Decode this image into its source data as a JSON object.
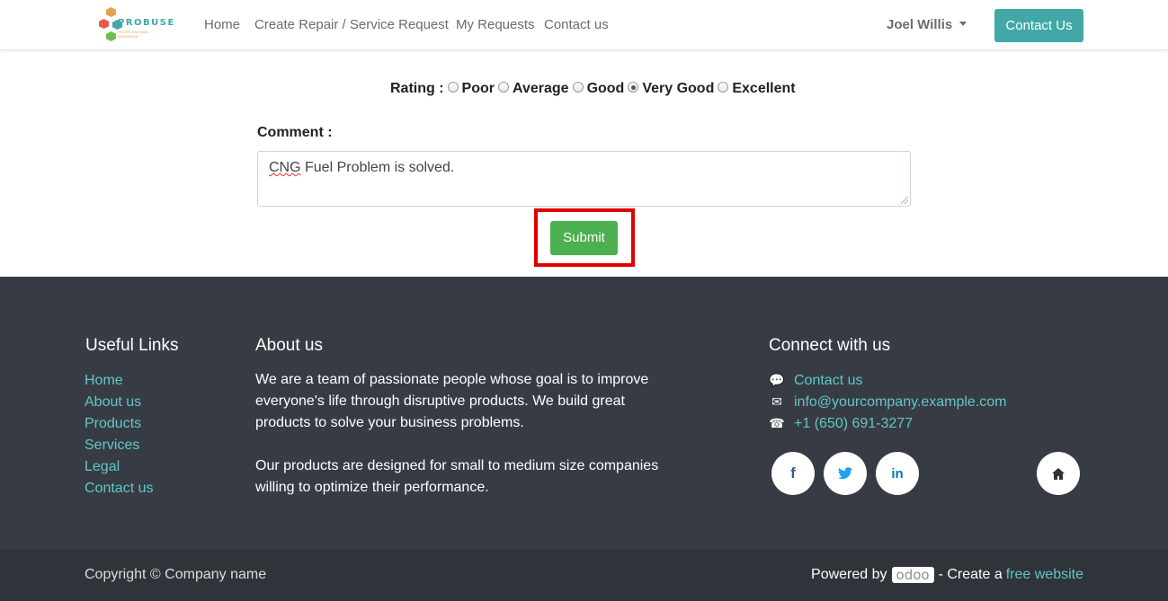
{
  "brand": {
    "logo_text": "PROBUSE",
    "logo_subtext": "PROFESSIONAL BUSINESS",
    "colors": {
      "teal": "#41a8a7",
      "orange": "#e8a04b",
      "green": "#4caf50",
      "red": "#e8594b"
    }
  },
  "nav": {
    "links": [
      "Home",
      "Create Repair / Service Request",
      "My Requests",
      "Contact us"
    ],
    "user_name": "Joel Willis",
    "cta_label": "Contact Us"
  },
  "form": {
    "rating_label": "Rating :",
    "rating_options": [
      "Poor",
      "Average",
      "Good",
      "Very Good",
      "Excellent"
    ],
    "selected_rating": "Good",
    "comment_label": "Comment :",
    "comment_spell_word": "CNG",
    "comment_rest": " Fuel Problem is solved.",
    "submit_label": "Submit"
  },
  "footer": {
    "useful_links_title": "Useful Links",
    "useful_links": [
      "Home",
      "About us",
      "Products",
      "Services",
      "Legal",
      "Contact us"
    ],
    "about_title": "About us",
    "about_p1": "We are a team of passionate people whose goal is to improve everyone's life through disruptive products. We build great products to solve your business problems.",
    "about_p2": "Our products are designed for small to medium size companies willing to optimize their performance.",
    "connect_title": "Connect with us",
    "contact_items": [
      {
        "icon": "comment-icon",
        "text": "Contact us"
      },
      {
        "icon": "envelope-icon",
        "text": "info@yourcompany.example.com"
      },
      {
        "icon": "phone-icon",
        "text": "+1 (650) 691-3277"
      }
    ],
    "social": [
      {
        "icon": "facebook-icon",
        "glyph": "f",
        "color": "#3b5998"
      },
      {
        "icon": "twitter-icon",
        "glyph": "🐦",
        "color": "#1da1f2"
      },
      {
        "icon": "linkedin-icon",
        "glyph": "in",
        "color": "#0077b5"
      },
      {
        "icon": "home-icon",
        "glyph": "⌂",
        "color": "#333333"
      }
    ],
    "copyright": "Copyright © Company name",
    "powered_by": "Powered by",
    "odoo": "odoo",
    "create_a": "- Create a",
    "free_website": "free website"
  }
}
